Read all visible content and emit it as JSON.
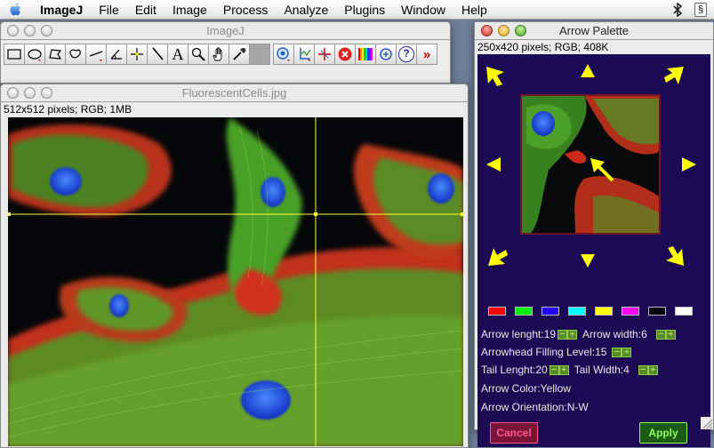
{
  "menubar": {
    "app_name": "ImageJ",
    "items": [
      "File",
      "Edit",
      "Image",
      "Process",
      "Analyze",
      "Plugins",
      "Window",
      "Help"
    ],
    "right_icons": [
      "bluetooth-icon",
      "script-menu-icon"
    ]
  },
  "toolbar_window": {
    "title": "ImageJ",
    "tools": [
      {
        "name": "rectangle-tool",
        "icon": "rectangle-icon"
      },
      {
        "name": "oval-tool",
        "icon": "oval-icon"
      },
      {
        "name": "polygon-tool",
        "icon": "polygon-icon"
      },
      {
        "name": "freehand-tool",
        "icon": "freehand-icon"
      },
      {
        "name": "line-tool",
        "icon": "line-icon"
      },
      {
        "name": "angle-tool",
        "icon": "angle-icon"
      },
      {
        "name": "point-tool",
        "icon": "crosshair-icon"
      },
      {
        "name": "wand-tool",
        "icon": "wand-icon"
      },
      {
        "name": "text-tool",
        "icon": "text-icon",
        "label": "A"
      },
      {
        "name": "magnifier-tool",
        "icon": "magnifier-icon"
      },
      {
        "name": "scroll-tool",
        "icon": "hand-icon"
      },
      {
        "name": "dropper-tool",
        "icon": "dropper-icon"
      },
      {
        "name": "color-picker-tool",
        "icon": "color-swatch-icon"
      },
      {
        "name": "zoom-tool",
        "icon": "zoom-icon"
      },
      {
        "name": "axis-tool",
        "icon": "axis-icon"
      },
      {
        "name": "cross-tool",
        "icon": "crosshair-red-icon"
      },
      {
        "name": "stop-tool",
        "icon": "stop-icon"
      },
      {
        "name": "lut-tool",
        "icon": "lut-icon"
      },
      {
        "name": "arrow-palette-tool",
        "icon": "arrow-palette-icon"
      },
      {
        "name": "help-tool",
        "icon": "help-icon",
        "label": "?"
      },
      {
        "name": "more-tools",
        "icon": "more-icon",
        "label": "»"
      }
    ]
  },
  "image_window": {
    "title": "FluorescentCells.jpg",
    "info": "512x512 pixels; RGB; 1MB"
  },
  "palette_window": {
    "title": "Arrow Palette",
    "info": "250x420 pixels; RGB; 408K",
    "swatch_colors": [
      "#ff0000",
      "#00ee00",
      "#2200ff",
      "#00ffff",
      "#ffff00",
      "#ff00ff",
      "#000000",
      "#ffffff"
    ],
    "arrow_color": "#ffff00",
    "labels": {
      "arrow_length": "Arrow lenght:19",
      "arrow_width": "Arrow width:6",
      "filling_level": "Arrowhead Filling Level:15",
      "tail_length": "Tail Lenght:20",
      "tail_width": "Tail Width:4",
      "arrow_color": "Arrow Color:Yellow",
      "orientation": "Arrow Orientation:N-W"
    },
    "buttons": {
      "cancel": "Cancel",
      "apply": "Apply"
    }
  }
}
